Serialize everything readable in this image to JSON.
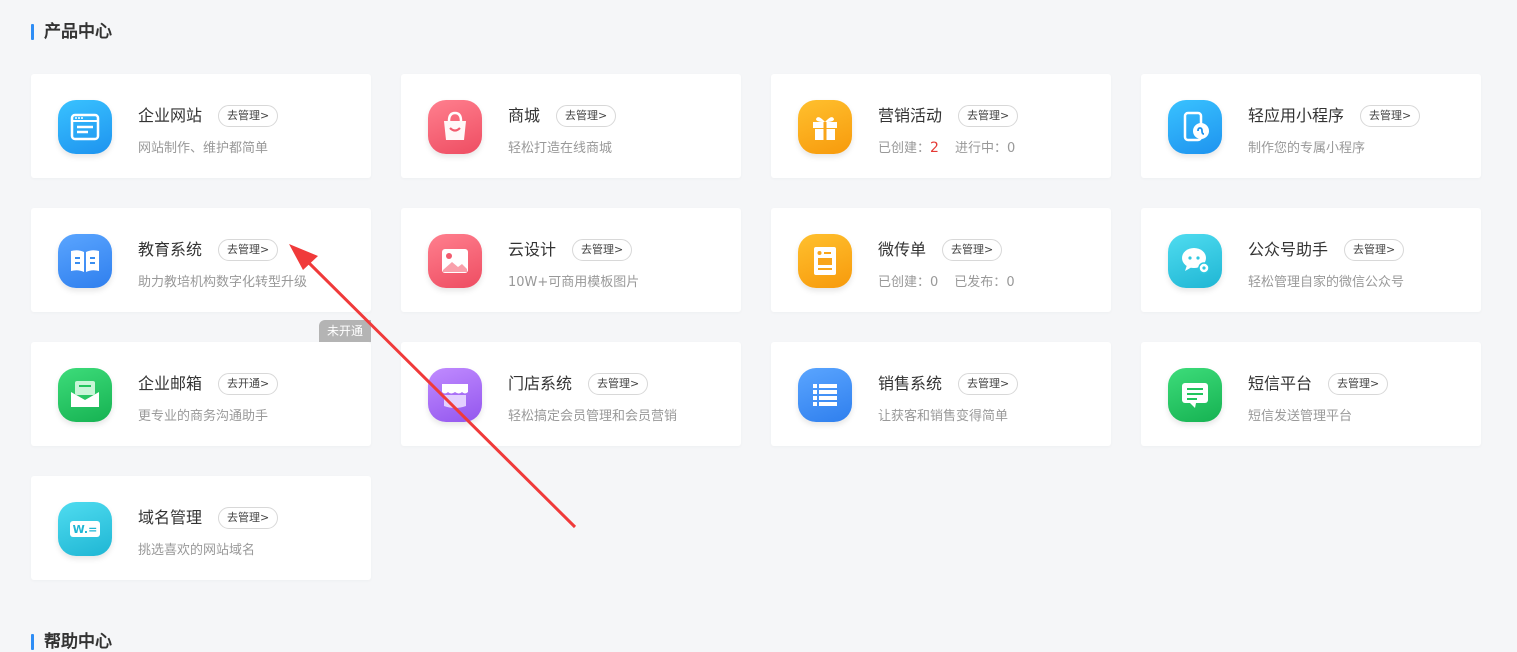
{
  "sections": {
    "product_center": "产品中心",
    "help_center": "帮助中心"
  },
  "cards": [
    {
      "name": "企业网站",
      "button": "去管理>",
      "desc": "网站制作、维护都简单",
      "icon": "website-icon",
      "color": "#1fa7f3"
    },
    {
      "name": "商城",
      "button": "去管理>",
      "desc": "轻松打造在线商城",
      "icon": "shopping-bag-icon",
      "color": "#f25b6e"
    },
    {
      "name": "营销活动",
      "button": "去管理>",
      "desc_label1": "已创建：",
      "desc_value1": "2",
      "desc_label2": "进行中：",
      "desc_value2": "0",
      "icon": "gift-icon",
      "color": "#f9a51a"
    },
    {
      "name": "轻应用小程序",
      "button": "去管理>",
      "desc": "制作您的专属小程序",
      "icon": "mini-program-icon",
      "color": "#1fa7f3"
    },
    {
      "name": "教育系统",
      "button": "去管理>",
      "desc": "助力教培机构数字化转型升级",
      "icon": "book-icon",
      "color": "#3a8ef0"
    },
    {
      "name": "云设计",
      "button": "去管理>",
      "desc": "10W+可商用模板图片",
      "icon": "image-icon",
      "color": "#f25b6e"
    },
    {
      "name": "微传单",
      "button": "去管理>",
      "desc_label1": "已创建：",
      "desc_value1": "0",
      "desc_label2": "已发布：",
      "desc_value2": "0",
      "icon": "flyer-icon",
      "color": "#f9a51a"
    },
    {
      "name": "公众号助手",
      "button": "去管理>",
      "desc": "轻松管理自家的微信公众号",
      "icon": "wechat-icon",
      "color": "#2ec8e0"
    },
    {
      "name": "企业邮箱",
      "button": "去开通>",
      "desc": "更专业的商务沟通助手",
      "icon": "mail-icon",
      "color": "#22c55e",
      "badge": "未开通"
    },
    {
      "name": "门店系统",
      "button": "去管理>",
      "desc": "轻松搞定会员管理和会员营销",
      "icon": "store-icon",
      "color": "#a66bf0"
    },
    {
      "name": "销售系统",
      "button": "去管理>",
      "desc": "让获客和销售变得简单",
      "icon": "list-icon",
      "color": "#3a8ef0"
    },
    {
      "name": "短信平台",
      "button": "去管理>",
      "desc": "短信发送管理平台",
      "icon": "sms-icon",
      "color": "#22c55e"
    },
    {
      "name": "域名管理",
      "button": "去管理>",
      "desc": "挑选喜欢的网站域名",
      "icon": "domain-icon",
      "color": "#2ec8e0",
      "icon_text": "W.="
    }
  ],
  "annotation": {
    "type": "red-arrow",
    "color": "#f03a3a"
  }
}
